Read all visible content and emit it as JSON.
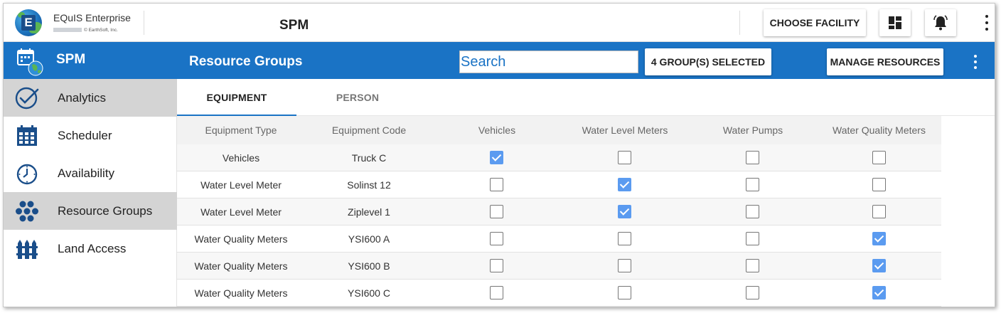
{
  "app": {
    "name": "EQuIS Enterprise",
    "copyright": "© EarthSoft, Inc.",
    "logo_letter": "E"
  },
  "header": {
    "page_title": "SPM",
    "choose_facility_label": "CHOOSE FACILITY",
    "dashboard_icon": "dashboard-icon",
    "notifications_icon": "bell-icon"
  },
  "module": {
    "label": "SPM",
    "section_title": "Resource Groups",
    "search_placeholder": "Search",
    "groups_selected_label": "4 GROUP(S) SELECTED",
    "manage_resources_label": "MANAGE RESOURCES"
  },
  "sidebar": {
    "items": [
      {
        "label": "Analytics",
        "icon": "analytics-check-icon",
        "active": true
      },
      {
        "label": "Scheduler",
        "icon": "calendar-icon",
        "active": false
      },
      {
        "label": "Availability",
        "icon": "clock-icon",
        "active": false
      },
      {
        "label": "Resource Groups",
        "icon": "hexagon-cluster-icon",
        "active": true
      },
      {
        "label": "Land Access",
        "icon": "fence-icon",
        "active": false
      }
    ]
  },
  "tabs": [
    {
      "label": "EQUIPMENT",
      "active": true
    },
    {
      "label": "PERSON",
      "active": false
    }
  ],
  "table": {
    "columns": [
      "Equipment Type",
      "Equipment Code",
      "Vehicles",
      "Water Level Meters",
      "Water Pumps",
      "Water Quality Meters"
    ],
    "rows": [
      {
        "type": "Vehicles",
        "code": "Truck C",
        "checks": [
          true,
          false,
          false,
          false
        ]
      },
      {
        "type": "Water Level Meter",
        "code": "Solinst 12",
        "checks": [
          false,
          true,
          false,
          false
        ]
      },
      {
        "type": "Water Level Meter",
        "code": "Ziplevel 1",
        "checks": [
          false,
          true,
          false,
          false
        ]
      },
      {
        "type": "Water Quality Meters",
        "code": "YSI600 A",
        "checks": [
          false,
          false,
          false,
          true
        ]
      },
      {
        "type": "Water Quality Meters",
        "code": "YSI600 B",
        "checks": [
          false,
          false,
          false,
          true
        ]
      },
      {
        "type": "Water Quality Meters",
        "code": "YSI600 C",
        "checks": [
          false,
          false,
          false,
          true
        ]
      }
    ]
  },
  "colors": {
    "brand_blue": "#1a73c5",
    "checkbox_blue": "#5b9bf0",
    "active_nav": "#d4d4d4"
  }
}
